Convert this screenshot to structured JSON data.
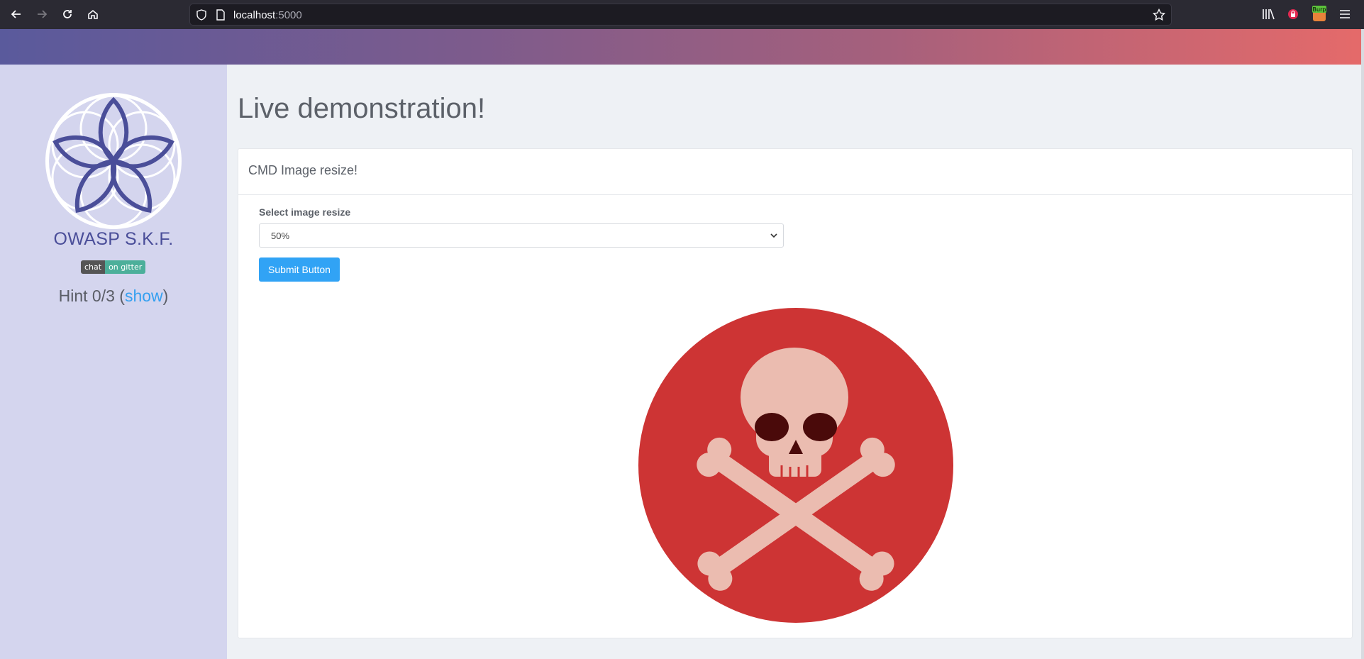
{
  "browser": {
    "url_host": "localhost",
    "url_port": ":5000",
    "ext_badge": "Burp"
  },
  "sidebar": {
    "brand": "OWASP S.K.F.",
    "badge_left": "chat",
    "badge_right": "on gitter",
    "hint_prefix": "Hint 0/3 (",
    "hint_link": "show",
    "hint_suffix": ")"
  },
  "main": {
    "title": "Live demonstration!",
    "card_header": "CMD Image resize!",
    "select_label": "Select image resize",
    "select_value": "50%",
    "submit_label": "Submit Button"
  },
  "colors": {
    "accent": "#31a3f5",
    "sidebar_bg": "#d4d5ee",
    "brand": "#4a4e99",
    "skull_bg": "#cd3434"
  }
}
